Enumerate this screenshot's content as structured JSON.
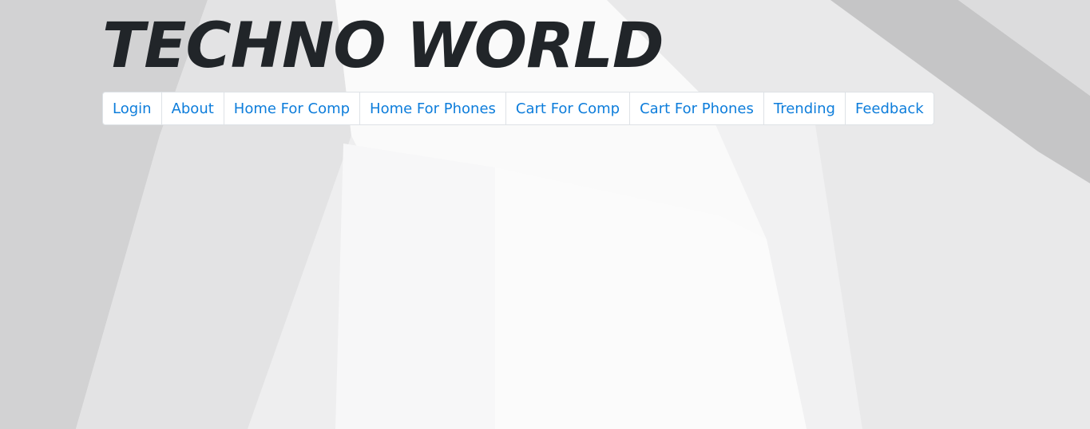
{
  "header": {
    "title": "TECHNO WORLD"
  },
  "nav": {
    "items": [
      {
        "label": "Login"
      },
      {
        "label": "About"
      },
      {
        "label": "Home For Comp"
      },
      {
        "label": "Home For Phones"
      },
      {
        "label": "Cart For Comp"
      },
      {
        "label": "Cart For Phones"
      },
      {
        "label": "Trending"
      },
      {
        "label": "Feedback"
      }
    ]
  },
  "colors": {
    "link": "#0d7ddb",
    "title": "#212529",
    "nav_border": "#dee2e6",
    "nav_background": "#ffffff"
  }
}
